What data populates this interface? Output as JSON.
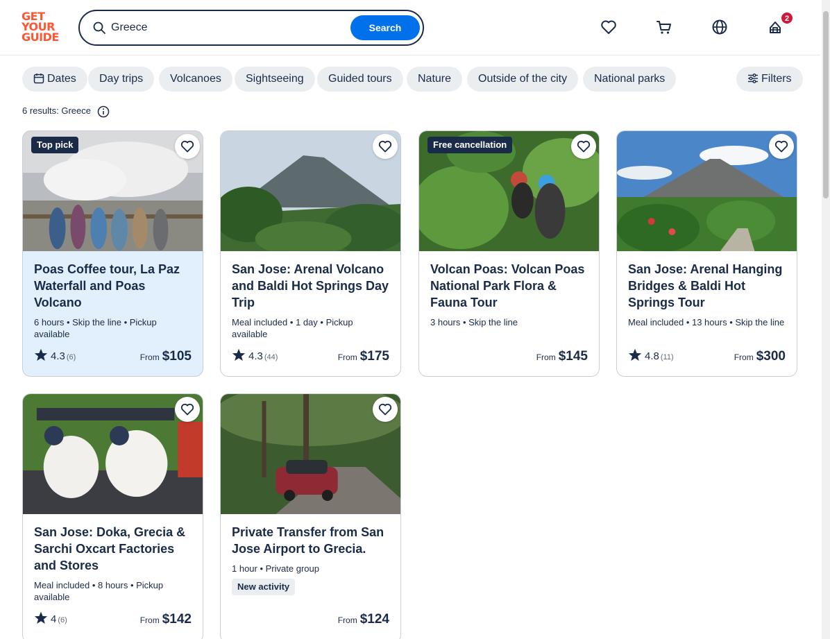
{
  "header": {
    "logo_lines": [
      "GET",
      "YOUR",
      "GUIDE"
    ],
    "search_value": "Greece",
    "search_button": "Search",
    "cart_badge": "2",
    "icons": [
      "heart-icon",
      "cart-icon",
      "globe-icon",
      "profile-icon"
    ]
  },
  "filters": {
    "chips": [
      "Dates",
      "Day trips",
      "Volcanoes",
      "Sightseeing",
      "Guided tours",
      "Nature",
      "Outside of the city",
      "National parks"
    ],
    "filters_button": "Filters"
  },
  "results_text": "6 results: Greece",
  "cards": [
    {
      "tag": "Top pick",
      "title": "Poas Coffee tour, La Paz Waterfall and Poas Volcano",
      "meta": "6 hours • Skip the line • Pickup available",
      "rating": "4.3",
      "reviews": "(6)",
      "from": "From",
      "price": "$105"
    },
    {
      "tag": "",
      "title": "San Jose: Arenal Volcano and Baldi Hot Springs Day Trip",
      "meta": "Meal included • 1 day • Pickup available",
      "rating": "4.3",
      "reviews": "(44)",
      "from": "From",
      "price": "$175"
    },
    {
      "tag": "Free cancellation",
      "title": "Volcan Poas: Volcan Poas National Park Flora & Fauna Tour",
      "meta": "3 hours • Skip the line",
      "rating": "",
      "reviews": "",
      "from": "From",
      "price": "$145"
    },
    {
      "tag": "",
      "title": "San Jose: Arenal Hanging Bridges & Baldi Hot Springs Tour",
      "meta": "Meal included • 13 hours • Skip the line",
      "rating": "4.8",
      "reviews": "(11)",
      "from": "From",
      "price": "$300"
    },
    {
      "tag": "",
      "title": "San Jose: Doka, Grecia & Sarchi Oxcart Factories and Stores",
      "meta": "Meal included • 8 hours • Pickup available",
      "rating": "4",
      "reviews": "(6)",
      "from": "From",
      "price": "$142"
    },
    {
      "tag": "",
      "title": "Private Transfer from San Jose Airport to Grecia.",
      "meta": "1 hour • Private group",
      "badge": "New activity",
      "rating": "",
      "reviews": "",
      "from": "From",
      "price": "$124"
    }
  ],
  "colors": {
    "brand": "#ff5533",
    "primary": "#0071eb",
    "text": "#1a2b49",
    "chip_bg": "#ebeef1",
    "highlight_card": "#e2f0fd",
    "badge_red": "#cd1a3b"
  }
}
